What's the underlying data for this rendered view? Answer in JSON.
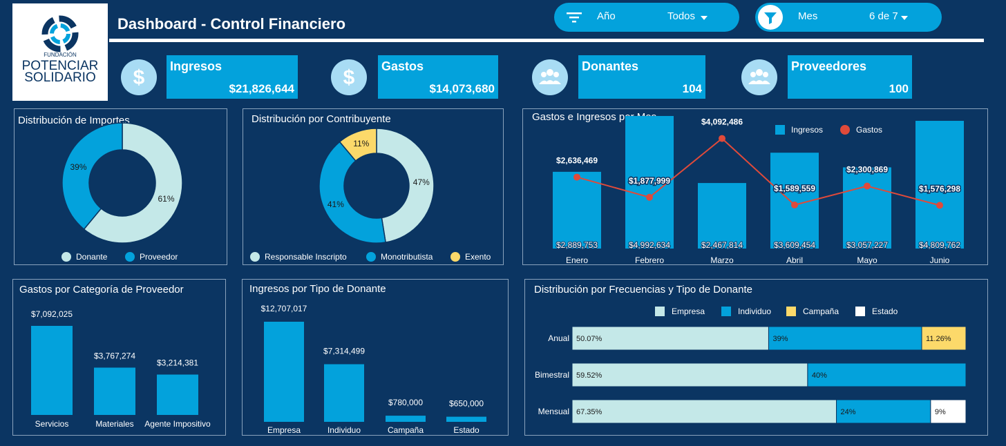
{
  "header": {
    "title": "Dashboard - Control Financiero",
    "logo": {
      "small": "FUNDACIÓN",
      "line1": "POTENCIAR",
      "line2": "SOLIDARIO"
    }
  },
  "filters": [
    {
      "label": "Año",
      "value": "Todos",
      "icon": "filter-lines-icon"
    },
    {
      "label": "Mes",
      "value": "6 de 7",
      "icon": "funnel-icon"
    }
  ],
  "kpis": [
    {
      "title": "Ingresos",
      "value": "$21,826,644",
      "icon": "dollar-icon"
    },
    {
      "title": "Gastos",
      "value": "$14,073,680",
      "icon": "dollar-icon"
    },
    {
      "title": "Donantes",
      "value": "104",
      "icon": "people-icon"
    },
    {
      "title": "Proveedores",
      "value": "100",
      "icon": "people-icon"
    }
  ],
  "colors": {
    "bg": "#0b3562",
    "blue": "#03a2dc",
    "light": "#c4e8e8",
    "yellow": "#fcd96a",
    "red": "#e04a3a",
    "white": "#ffffff"
  },
  "chart_data": [
    {
      "type": "pie",
      "title": "Distribución de Importes",
      "categories": [
        "Donante",
        "Proveedor"
      ],
      "values": [
        61,
        39
      ],
      "labels": [
        "61%",
        "39%"
      ],
      "colors": [
        "#c4e8e8",
        "#03a2dc"
      ],
      "legend": "bottom"
    },
    {
      "type": "pie",
      "title": "Distribución por Contribuyente",
      "categories": [
        "Responsable Inscripto",
        "Monotributista",
        "Exento"
      ],
      "values": [
        47,
        41,
        11
      ],
      "labels": [
        "47%",
        "41%",
        "11%"
      ],
      "colors": [
        "#c4e8e8",
        "#03a2dc",
        "#fcd96a"
      ],
      "legend": "bottom"
    },
    {
      "type": "bar",
      "title": "Gastos e Ingresos por Mes",
      "categories": [
        "Enero",
        "Febrero",
        "Marzo",
        "Abril",
        "Mayo",
        "Junio"
      ],
      "series": [
        {
          "name": "Ingresos",
          "type": "bar",
          "values": [
            2889753,
            4992634,
            2467814,
            3609454,
            3057227,
            4809762
          ],
          "labels": [
            "$2,889,753",
            "$4,992,634",
            "$2,467,814",
            "$3,609,454",
            "$3,057,227",
            "$4,809,762"
          ]
        },
        {
          "name": "Gastos",
          "type": "line",
          "values": [
            2636469,
            1877999,
            4092486,
            1589559,
            2300869,
            1576298
          ],
          "labels": [
            "$2,636,469",
            "$1,877,999",
            "$4,092,486",
            "$1,589,559",
            "$2,300,869",
            "$1,576,298"
          ]
        }
      ],
      "ylim": [
        0,
        5200000
      ],
      "legend": "top-right"
    },
    {
      "type": "bar",
      "title": "Gastos por Categoría de Proveedor",
      "categories": [
        "Servicios",
        "Materiales",
        "Agente Impositivo"
      ],
      "values": [
        7092025,
        3767274,
        3214381
      ],
      "labels": [
        "$7,092,025",
        "$3,767,274",
        "$3,214,381"
      ],
      "ylim": [
        0,
        7092025
      ]
    },
    {
      "type": "bar",
      "title": "Ingresos por Tipo de Donante",
      "categories": [
        "Empresa",
        "Individuo",
        "Campaña",
        "Estado"
      ],
      "values": [
        12707017,
        7314499,
        780000,
        650000
      ],
      "labels": [
        "$12,707,017",
        "$7,314,499",
        "$780,000",
        "$650,000"
      ],
      "ylim": [
        0,
        12707017
      ]
    },
    {
      "type": "bar",
      "orientation": "horizontal-stacked-100",
      "title": "Distribución por Frecuencias y Tipo de Donante",
      "categories": [
        "Anual",
        "Bimestral",
        "Mensual"
      ],
      "series": [
        {
          "name": "Empresa",
          "values": [
            50.07,
            59.52,
            67.35
          ],
          "labels": [
            "50.07%",
            "59.52%",
            "67.35%"
          ]
        },
        {
          "name": "Individuo",
          "values": [
            39,
            40,
            24
          ],
          "labels": [
            "39%",
            "40%",
            "24%"
          ]
        },
        {
          "name": "Campaña",
          "values": [
            11.26,
            0,
            0
          ],
          "labels": [
            "11.26%",
            "",
            ""
          ]
        },
        {
          "name": "Estado",
          "values": [
            0,
            0,
            9
          ],
          "labels": [
            "",
            "",
            "9%"
          ]
        }
      ],
      "colors": [
        "#c4e8e8",
        "#03a2dc",
        "#fcd96a",
        "#ffffff"
      ],
      "legend": "top"
    }
  ]
}
